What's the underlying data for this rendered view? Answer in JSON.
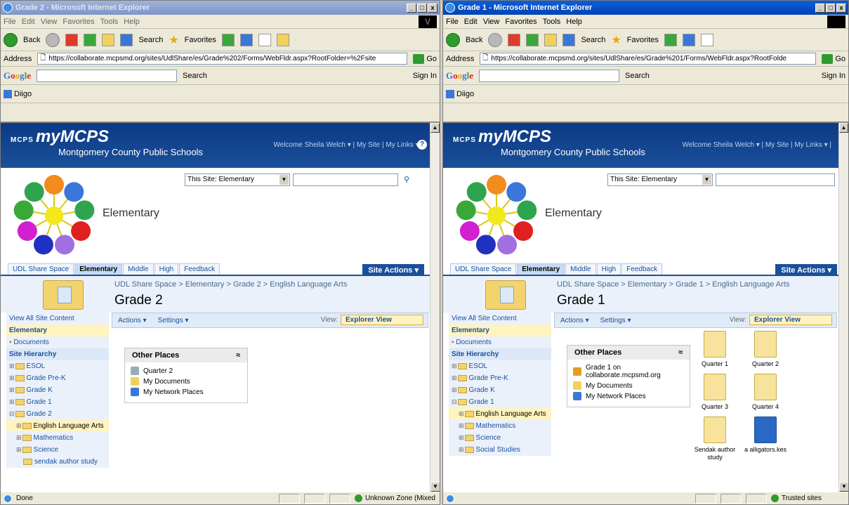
{
  "left": {
    "title": "Grade 2 - Microsoft Internet Explorer",
    "menu": [
      "File",
      "Edit",
      "View",
      "Favorites",
      "Tools",
      "Help"
    ],
    "toolbar": {
      "back": "Back",
      "search": "Search",
      "favorites": "Favorites"
    },
    "address_label": "Address",
    "url": "https://collaborate.mcpsmd.org/sites/UdlShare/es/Grade%202/Forms/WebFldr.aspx?RootFolder=%2Fsite",
    "go": "Go",
    "google_search": "Search",
    "sign_in": "Sign In",
    "digo": "Diigo",
    "banner": {
      "small": "MCPS",
      "title": "myMCPS",
      "subtitle": "Montgomery County Public Schools",
      "links": "Welcome Sheila Welch ▾ | My Site | My Links ▾ |"
    },
    "scope": "This Site: Elementary",
    "site_title": "Elementary",
    "tabs": [
      "UDL Share Space",
      "Elementary",
      "Middle",
      "High",
      "Feedback"
    ],
    "site_actions": "Site Actions ▾",
    "breadcrumb": "UDL Share Space > Elementary > Grade 2 > English Language Arts",
    "page_title": "Grade 2",
    "nav": {
      "view_all": "View All Site Content",
      "elementary": "Elementary",
      "documents": "Documents",
      "hierarchy": "Site Hierarchy",
      "items": [
        "ESOL",
        "Grade Pre-K",
        "Grade K",
        "Grade 1",
        "Grade 2"
      ],
      "subitems": [
        "English Language Arts",
        "Mathematics",
        "Science",
        "sendak author study"
      ]
    },
    "actions": "Actions ▾",
    "settings": "Settings ▾",
    "view_label": "View:",
    "view_value": "Explorer View",
    "other_places": {
      "title": "Other Places",
      "items": [
        "Quarter 2",
        "My Documents",
        "My Network Places"
      ]
    },
    "status": "Done",
    "zone": "Unknown Zone (Mixed"
  },
  "right": {
    "title": "Grade 1 - Microsoft Internet Explorer",
    "menu": [
      "File",
      "Edit",
      "View",
      "Favorites",
      "Tools",
      "Help"
    ],
    "toolbar": {
      "back": "Back",
      "search": "Search",
      "favorites": "Favorites"
    },
    "address_label": "Address",
    "url": "https://collaborate.mcpsmd.org/sites/UdlShare/es/Grade%201/Forms/WebFldr.aspx?RootFolde",
    "go": "Go",
    "google_search": "Search",
    "sign_in": "Sign In",
    "digo": "Diigo",
    "banner": {
      "small": "MCPS",
      "title": "myMCPS",
      "subtitle": "Montgomery County Public Schools",
      "links": "Welcome Sheila Welch ▾ | My Site | My Links ▾ |"
    },
    "scope": "This Site: Elementary",
    "site_title": "Elementary",
    "tabs": [
      "UDL Share Space",
      "Elementary",
      "Middle",
      "High",
      "Feedback"
    ],
    "site_actions": "Site Actions ▾",
    "breadcrumb": "UDL Share Space > Elementary > Grade 1 > English Language Arts",
    "page_title": "Grade 1",
    "nav": {
      "view_all": "View All Site Content",
      "elementary": "Elementary",
      "documents": "Documents",
      "hierarchy": "Site Hierarchy",
      "items": [
        "ESOL",
        "Grade Pre-K",
        "Grade K",
        "Grade 1"
      ],
      "subitems": [
        "English Language Arts",
        "Mathematics",
        "Science",
        "Social Studies"
      ]
    },
    "actions": "Actions ▾",
    "settings": "Settings ▾",
    "view_label": "View:",
    "view_value": "Explorer View",
    "other_places": {
      "title": "Other Places",
      "items": [
        "Grade 1 on collaborate.mcpsmd.org",
        "My Documents",
        "My Network Places"
      ]
    },
    "files": [
      "Quarter 1",
      "Quarter 2",
      "Quarter 3",
      "Quarter 4",
      "Sendak author study",
      "a alligators.kes"
    ],
    "status": "",
    "zone": "Trusted sites"
  },
  "colors": {
    "banner": "#0d3a84",
    "accent": "#1a4f9a",
    "highlight": "#fff3c0"
  },
  "wheel_colors": [
    "#f28c1c",
    "#3a77d8",
    "#2ea44f",
    "#e02020",
    "#a070e0",
    "#2030c0",
    "#d020d0",
    "#39a839",
    "#2ea44f",
    "#f2e81a"
  ]
}
